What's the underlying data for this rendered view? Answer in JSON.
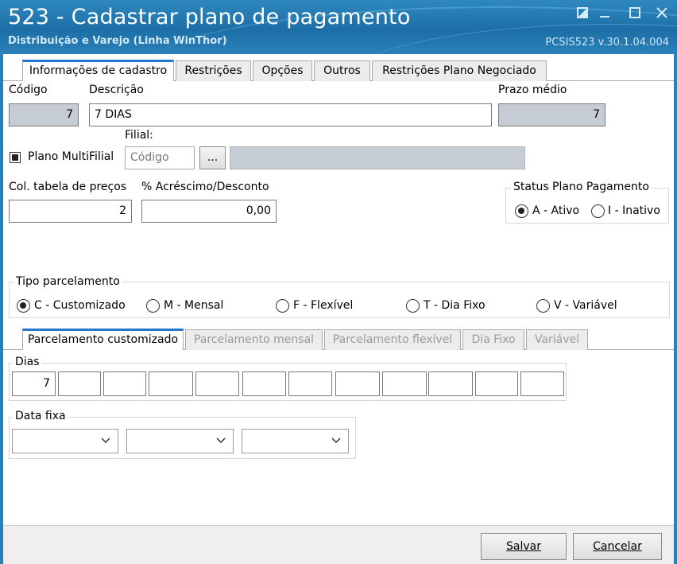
{
  "window": {
    "title": "523 - Cadastrar plano de pagamento",
    "subtitle": "Distribuição e Varejo (Linha WinThor)",
    "version": "PCSIS523  v.30.1.04.004"
  },
  "main_tabs": [
    {
      "label": "Informações de cadastro",
      "active": true
    },
    {
      "label": "Restrições",
      "active": false
    },
    {
      "label": "Opções",
      "active": false
    },
    {
      "label": "Outros",
      "active": false
    },
    {
      "label": "Restrições Plano Negociado",
      "active": false
    }
  ],
  "form": {
    "codigo_label": "Código",
    "codigo_value": "7",
    "descricao_label": "Descrição",
    "descricao_value": "7 DIAS",
    "prazo_label": "Prazo médio",
    "prazo_value": "7",
    "multifilial_label": "Plano MultiFilial",
    "multifilial_checked": true,
    "filial_label": "Filial:",
    "filial_placeholder": "Código",
    "filial_button": "...",
    "col_tabela_label": "Col. tabela de preços",
    "col_tabela_value": "2",
    "acrescimo_label": "% Acréscimo/Desconto",
    "acrescimo_value": "0,00"
  },
  "status": {
    "title": "Status Plano Pagamento",
    "options": [
      {
        "label": "A - Ativo",
        "selected": true
      },
      {
        "label": "I - Inativo",
        "selected": false
      }
    ]
  },
  "tipo_parcelamento": {
    "title": "Tipo parcelamento",
    "options": [
      {
        "label": "C - Customizado",
        "selected": true
      },
      {
        "label": "M - Mensal",
        "selected": false
      },
      {
        "label": "F - Flexível",
        "selected": false
      },
      {
        "label": "T - Dia Fixo",
        "selected": false
      },
      {
        "label": "V - Variável",
        "selected": false
      }
    ]
  },
  "parcel_tabs": [
    {
      "label": "Parcelamento customizado",
      "active": true,
      "enabled": true
    },
    {
      "label": "Parcelamento mensal",
      "active": false,
      "enabled": false
    },
    {
      "label": "Parcelamento flexível",
      "active": false,
      "enabled": false
    },
    {
      "label": "Dia Fixo",
      "active": false,
      "enabled": false
    },
    {
      "label": "Variável",
      "active": false,
      "enabled": false
    }
  ],
  "dias": {
    "title": "Dias",
    "values": [
      "7",
      "",
      "",
      "",
      "",
      "",
      "",
      "",
      "",
      "",
      "",
      ""
    ]
  },
  "data_fixa": {
    "title": "Data fixa",
    "selects": [
      "",
      "",
      ""
    ]
  },
  "buttons": {
    "salvar": "Salvar",
    "cancelar": "Cancelar"
  },
  "colors": {
    "titlebar": "#2a80b8",
    "active_tab_accent": "#2179d3",
    "readonly_field": "#c5ccd4"
  }
}
